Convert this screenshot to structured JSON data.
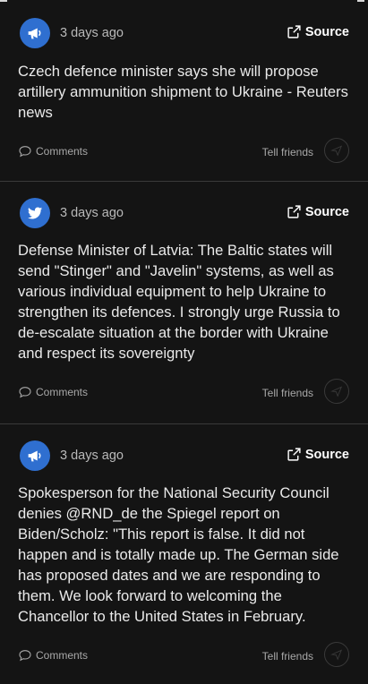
{
  "feed": {
    "posts": [
      {
        "source_type": "news",
        "time": "3 days ago",
        "source_label": "Source",
        "text": "Czech defence minister says she will propose artillery ammunition shipment to Ukraine - Reuters news",
        "comments_label": "Comments",
        "tell_friends_label": "Tell friends"
      },
      {
        "source_type": "twitter",
        "time": "3 days ago",
        "source_label": "Source",
        "text": "Defense Minister of Latvia: The Baltic states will send \"Stinger\" and \"Javelin\" systems, as well as various individual equipment to help Ukraine to strengthen its defences. I strongly urge Russia to de-escalate situation at the border with Ukraine and respect its sovereignty",
        "comments_label": "Comments",
        "tell_friends_label": "Tell friends"
      },
      {
        "source_type": "news",
        "time": "3 days ago",
        "source_label": "Source",
        "text": "Spokesperson for the National Security Council denies @RND_de the Spiegel report on Biden/Scholz: \"This report is false. It did not happen and is totally made up. The German side has proposed dates and we are responding to them. We look forward to welcoming the Chancellor to the United States in February.",
        "comments_label": "Comments",
        "tell_friends_label": "Tell friends"
      }
    ]
  },
  "colors": {
    "background": "#141414",
    "avatar": "#2f6fd0",
    "divider": "#3a3a3a"
  }
}
